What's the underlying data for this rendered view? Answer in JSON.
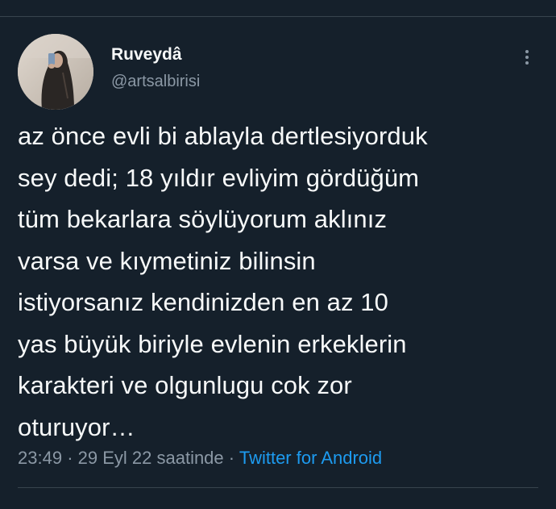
{
  "tweet": {
    "author": {
      "display_name": "Ruveydâ",
      "handle": "@artsalbirisi"
    },
    "text": "az önce evli bi ablayla dertlesiyorduk\nsey dedi; 18 yıldır evliyim gördüğüm\ntüm bekarlara söylüyorum aklınız\nvarsa ve kıymetiniz bilinsin\nistiyorsanız kendinizden en az 10\nyas büyük biriyle evlenin erkeklerin\nkarakteri ve olgunlugu cok zor\noturuyor…",
    "time": "23:49",
    "separator": "·",
    "date": "29 Eyl 22 saatinde",
    "source": "Twitter for Android"
  },
  "icons": {
    "more": "more-vertical-icon",
    "avatar": "profile-photo"
  },
  "colors": {
    "background": "#15202b",
    "text_primary": "#f7f9f9",
    "text_secondary": "#8b98a5",
    "link": "#1d9bf0",
    "divider": "#38444d"
  }
}
